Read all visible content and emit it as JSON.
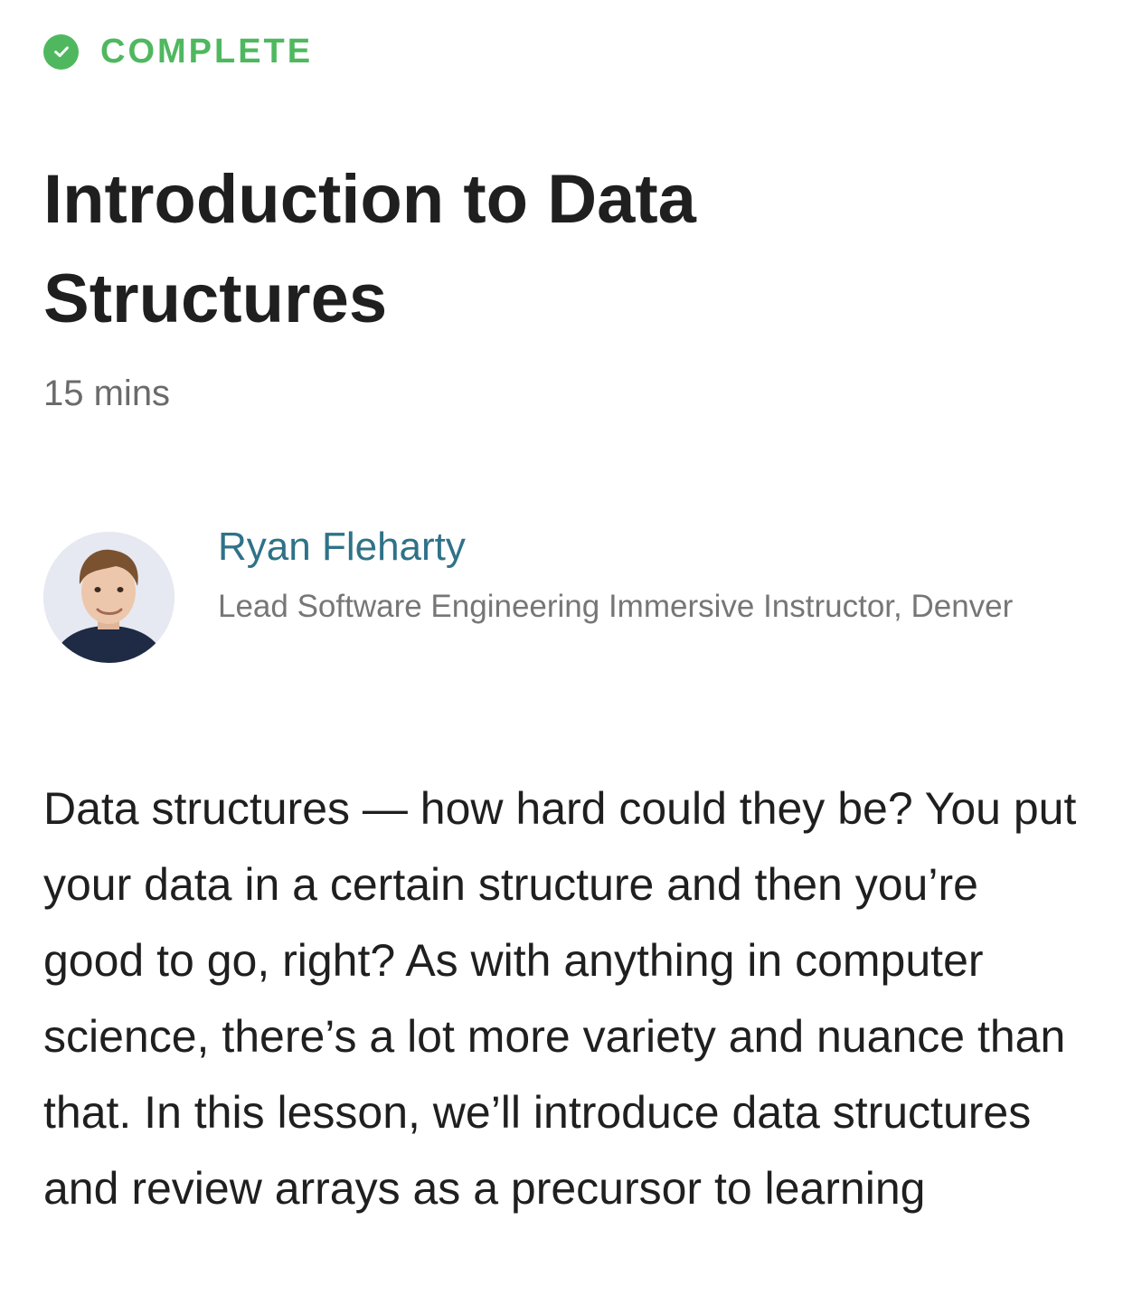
{
  "lesson": {
    "status": {
      "label": "COMPLETE",
      "icon": "check-circle-icon",
      "color": "#4fb85f"
    },
    "title": "Introduction to Data Structures",
    "duration": "15 mins",
    "author": {
      "name": "Ryan Fleharty",
      "role": "Lead Software Engineering Immersive Instructor, Denver",
      "name_color": "#2f7288",
      "avatar_icon": "avatar-photo"
    },
    "description": "Data structures — how hard could they be? You put your data in a certain structure and then you’re good to go, right? As with anything in computer science, there’s a lot more variety and nuance than that. In this lesson, we’ll introduce data structures and review arrays as a precursor to learning"
  }
}
